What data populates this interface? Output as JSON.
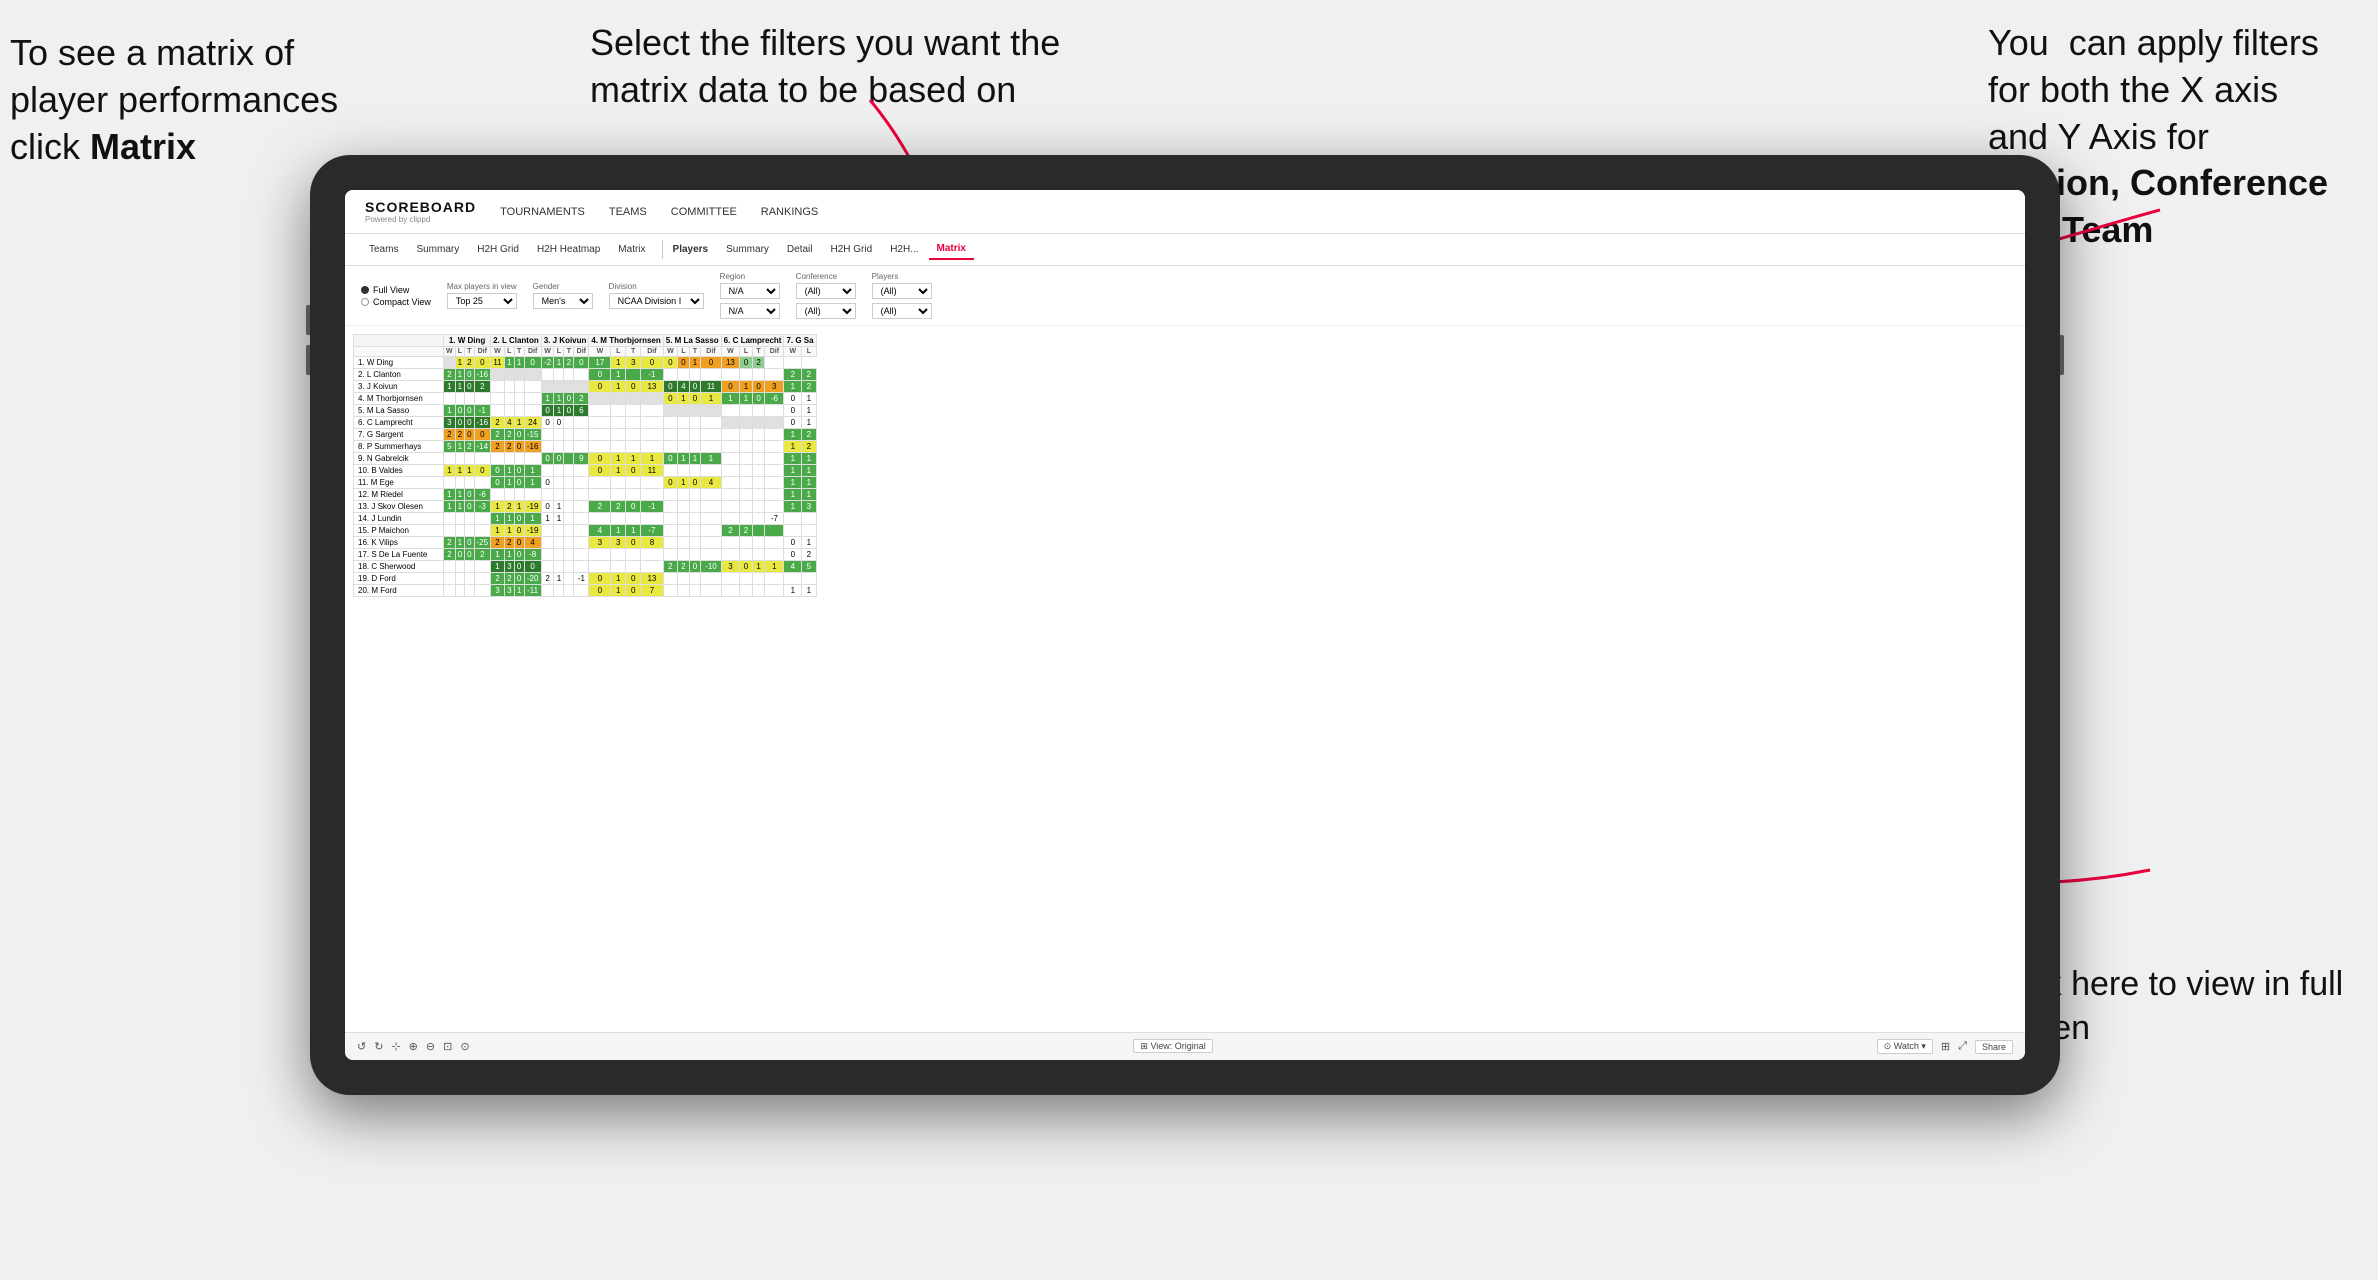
{
  "annotations": {
    "top_left": "To see a matrix of player performances click Matrix",
    "top_left_bold": "Matrix",
    "top_center": "Select the filters you want the matrix data to be based on",
    "top_right_line1": "You  can apply filters for both the X axis and Y Axis for ",
    "top_right_bold": "Region, Conference and Team",
    "bottom_right": "Click here to view in full screen"
  },
  "nav": {
    "logo_main": "SCOREBOARD",
    "logo_sub": "Powered by clippd",
    "items": [
      "TOURNAMENTS",
      "TEAMS",
      "COMMITTEE",
      "RANKINGS"
    ]
  },
  "sub_nav": {
    "items": [
      "Teams",
      "Summary",
      "H2H Grid",
      "H2H Heatmap",
      "Matrix",
      "Players",
      "Summary",
      "Detail",
      "H2H Grid",
      "H2H...",
      "Matrix"
    ]
  },
  "filters": {
    "view_options": [
      "Full View",
      "Compact View"
    ],
    "max_players_label": "Max players in view",
    "max_players_value": "Top 25",
    "gender_label": "Gender",
    "gender_value": "Men's",
    "division_label": "Division",
    "division_value": "NCAA Division I",
    "region_label": "Region",
    "region_value1": "N/A",
    "region_value2": "N/A",
    "conference_label": "Conference",
    "conference_value1": "(All)",
    "conference_value2": "(All)",
    "players_label": "Players",
    "players_value1": "(All)",
    "players_value2": "(All)"
  },
  "matrix": {
    "column_headers": [
      "1. W Ding",
      "2. L Clanton",
      "3. J Koivun",
      "4. M Thorbjornsen",
      "5. M La Sasso",
      "6. C Lamprecht",
      "7. G Sa"
    ],
    "sub_headers": [
      "W",
      "L",
      "T",
      "Dif"
    ],
    "rows": [
      {
        "name": "1. W Ding",
        "data": [
          [
            " ",
            "1",
            "2",
            "0",
            "11"
          ],
          [
            "1",
            "1",
            "0",
            "-2"
          ],
          [
            "1",
            "2",
            "0",
            "17"
          ],
          [
            "1",
            "3",
            "0",
            "0"
          ],
          [
            "0",
            "1",
            "0",
            "13"
          ],
          [
            "0",
            "2"
          ]
        ]
      },
      {
        "name": "2. L Clanton",
        "data": [
          [
            "2",
            "1",
            "0",
            "-16"
          ],
          [
            ""
          ],
          [
            ""
          ],
          [
            "0",
            "1",
            "-1"
          ],
          [
            ""
          ],
          [
            ""
          ],
          [
            ""
          ],
          [
            ""
          ],
          [
            "2",
            "2"
          ]
        ]
      },
      {
        "name": "3. J Koivun",
        "data": [
          [
            "1",
            "1",
            "0",
            "2"
          ],
          [
            ""
          ],
          [
            "0",
            "1",
            "0",
            "13"
          ],
          [
            "0",
            "4",
            "0",
            "11"
          ],
          [
            "0",
            "1",
            "0",
            "3"
          ],
          [
            "1",
            "2"
          ]
        ]
      },
      {
        "name": "4. M Thorbjornsen",
        "data": [
          [
            ""
          ],
          [
            ""
          ],
          [
            "1",
            "1",
            "0",
            "2"
          ],
          [
            "0",
            "1",
            "0",
            "1"
          ],
          [
            "1",
            "1",
            "0",
            "-6"
          ],
          [
            "0",
            "1"
          ]
        ]
      },
      {
        "name": "5. M La Sasso",
        "data": [
          [
            "1",
            "0",
            "0",
            "-1"
          ],
          [
            ""
          ],
          [
            "0",
            "1",
            "0",
            "6"
          ],
          [
            ""
          ],
          [
            ""
          ],
          [
            ""
          ],
          [
            ""
          ],
          [
            "0",
            "1"
          ]
        ]
      },
      {
        "name": "6. C Lamprecht",
        "data": [
          [
            "3",
            "0",
            "0",
            "-16"
          ],
          [
            "2",
            "4",
            "1",
            "24"
          ],
          [
            "0",
            "0"
          ],
          [
            ""
          ],
          [
            ""
          ],
          [
            "0",
            "2",
            "-16"
          ],
          [
            ""
          ],
          [
            ""
          ],
          [
            "0",
            "1"
          ]
        ]
      },
      {
        "name": "7. G Sargent",
        "data": [
          [
            "2",
            "2",
            "0",
            "0"
          ],
          [
            "2",
            "2",
            "0",
            "-15"
          ],
          [
            ""
          ],
          [
            ""
          ],
          [
            ""
          ],
          [
            ""
          ],
          [
            "1",
            "2"
          ]
        ]
      },
      {
        "name": "8. P Summerhays",
        "data": [
          [
            "5",
            "1",
            "2",
            "-14"
          ],
          [
            "2",
            "2",
            "0",
            "-16"
          ],
          [
            ""
          ],
          [
            ""
          ],
          [
            ""
          ],
          [
            ""
          ],
          [
            "1",
            "2"
          ]
        ]
      },
      {
        "name": "9. N Gabrelcik",
        "data": [
          [
            ""
          ],
          [
            ""
          ],
          [
            "0",
            "0",
            "9"
          ],
          [
            "0",
            "1",
            "1",
            "1"
          ],
          [
            "0",
            "1",
            "1",
            "1"
          ],
          [
            ""
          ],
          [
            "1",
            "1"
          ]
        ]
      },
      {
        "name": "10. B Valdes",
        "data": [
          [
            "1",
            "1",
            "1",
            "0"
          ],
          [
            "0",
            "1",
            "0",
            "1"
          ],
          [
            ""
          ],
          [
            "0",
            "1",
            "0",
            "11"
          ],
          [
            ""
          ],
          [
            ""
          ],
          [
            "1",
            "1"
          ]
        ]
      },
      {
        "name": "11. M Ege",
        "data": [
          [
            ""
          ],
          [
            "0",
            "1",
            "0",
            "1"
          ],
          [
            "0"
          ],
          [
            ""
          ],
          [
            "0",
            "1",
            "0",
            "4"
          ],
          [
            ""
          ],
          [
            "1",
            "1"
          ]
        ]
      },
      {
        "name": "12. M Riedel",
        "data": [
          [
            "1",
            "1",
            "0",
            "-6"
          ],
          [
            ""
          ],
          [
            ""
          ],
          [
            ""
          ],
          [
            ""
          ],
          [
            ""
          ],
          [
            "1",
            "1"
          ]
        ]
      },
      {
        "name": "13. J Skov Olesen",
        "data": [
          [
            "1",
            "1",
            "0",
            "-3"
          ],
          [
            "1",
            "2",
            "1",
            "-19"
          ],
          [
            "0",
            "1"
          ],
          [
            "2",
            "2",
            "0",
            "-1"
          ],
          [
            ""
          ],
          [
            ""
          ],
          [
            "1",
            "3"
          ]
        ]
      },
      {
        "name": "14. J Lundin",
        "data": [
          [
            ""
          ],
          [
            "1",
            "1",
            "0",
            "1"
          ],
          [
            "1",
            "1"
          ],
          [
            ""
          ],
          [
            ""
          ],
          [
            ""
          ],
          [
            ""
          ],
          [
            ""
          ],
          [
            "",
            "-7"
          ]
        ]
      },
      {
        "name": "15. P Maichon",
        "data": [
          [
            ""
          ],
          [
            "1",
            "1",
            "0",
            "-19"
          ],
          [
            ""
          ],
          [
            "4",
            "1",
            "1",
            "0",
            "-7"
          ],
          [
            "2",
            "2"
          ]
        ]
      },
      {
        "name": "16. K Vilips",
        "data": [
          [
            "2",
            "1",
            "0",
            "-25"
          ],
          [
            "2",
            "2",
            "0",
            "4"
          ],
          [
            "3",
            "3",
            "0",
            "8"
          ],
          [
            ""
          ],
          [
            ""
          ],
          [
            ""
          ],
          [
            "0",
            "1"
          ]
        ]
      },
      {
        "name": "17. S De La Fuente",
        "data": [
          [
            "2",
            "0",
            "0",
            "2"
          ],
          [
            "1",
            "1",
            "0",
            "-8"
          ],
          [
            ""
          ],
          [
            ""
          ],
          [
            ""
          ],
          [
            ""
          ],
          [
            "0",
            "2"
          ]
        ]
      },
      {
        "name": "18. C Sherwood",
        "data": [
          [
            ""
          ],
          [
            "1",
            "3",
            "0",
            "0"
          ],
          [
            ""
          ],
          [
            ""
          ],
          [
            "2",
            "2",
            "0",
            "-10"
          ],
          [
            "3",
            "0",
            "1",
            "1"
          ],
          [
            "4",
            "5"
          ]
        ]
      },
      {
        "name": "19. D Ford",
        "data": [
          [
            ""
          ],
          [
            "2",
            "2",
            "0",
            "-20"
          ],
          [
            "2",
            "1",
            "-1"
          ],
          [
            "0",
            "1",
            "0",
            "13"
          ],
          [
            ""
          ],
          [
            "",
            ""
          ]
        ]
      },
      {
        "name": "20. M Ford",
        "data": [
          [
            ""
          ],
          [
            "3",
            "3",
            "1",
            "-11"
          ],
          [
            ""
          ],
          [
            "0",
            "1",
            "0",
            "7"
          ],
          [
            ""
          ],
          [
            ""
          ],
          [
            "1",
            "1"
          ]
        ]
      }
    ]
  },
  "toolbar": {
    "view_original": "⊞ View: Original",
    "watch": "⊙ Watch ▾",
    "share": "Share"
  }
}
